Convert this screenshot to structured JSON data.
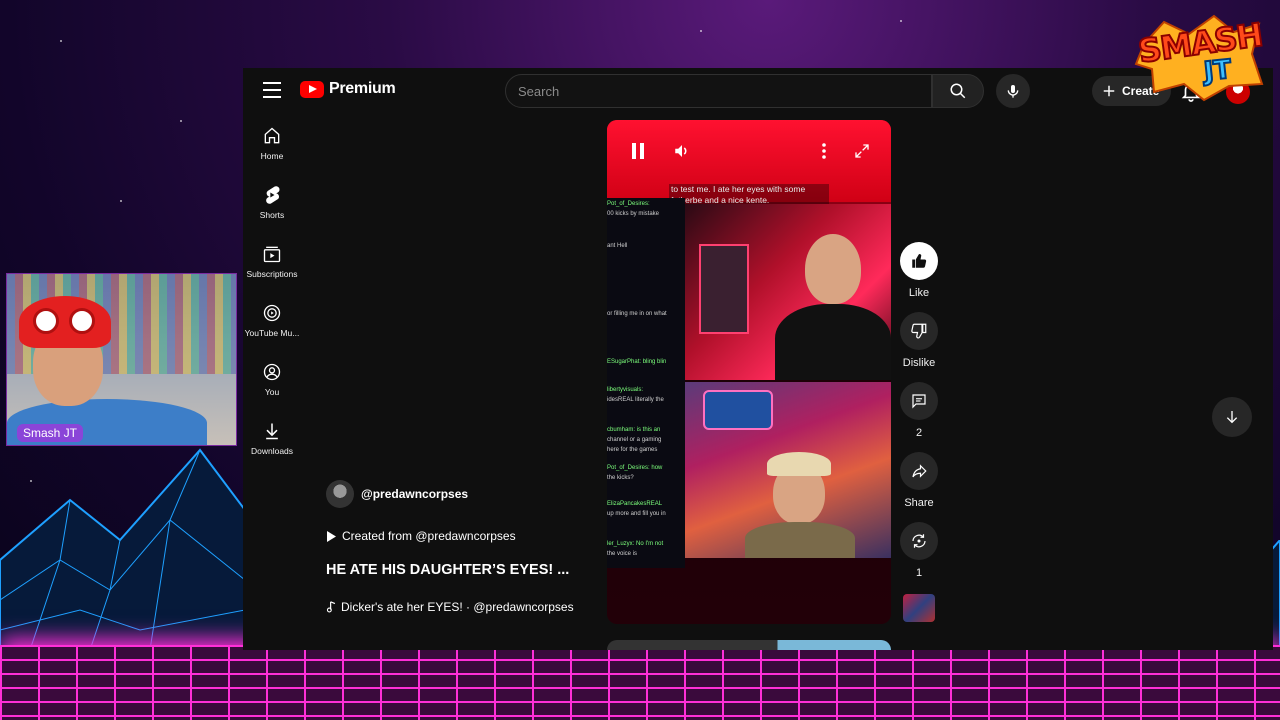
{
  "app": {
    "logo_text": "Premium",
    "search_placeholder": "Search",
    "create_label": "Create",
    "notification_count": "4"
  },
  "sidebar": {
    "items": [
      {
        "label": "Home",
        "icon": "home-icon"
      },
      {
        "label": "Shorts",
        "icon": "shorts-icon"
      },
      {
        "label": "Subscriptions",
        "icon": "subscriptions-icon"
      },
      {
        "label": "YouTube Mu...",
        "icon": "youtube-music-icon"
      },
      {
        "label": "You",
        "icon": "you-icon"
      },
      {
        "label": "Downloads",
        "icon": "download-icon"
      }
    ]
  },
  "video": {
    "caption": "to test me. I ate her eyes with some fatherbe and a nice kente.",
    "chat_lines": [
      "Pot_of_Desires:",
      "00 kicks by mistake",
      "ant Hell",
      "or filling me in on what",
      "ESugarPhat: bling blin",
      "libertyvisuals:",
      "idesREAL literally the",
      "cbumham: is this an",
      "channel or a gaming",
      "here for the games",
      "Pot_of_Desires: how",
      "the kicks?",
      "ElizaPancakesREAL",
      "up more and fill you in",
      "ler_Luzyx: No I'm not",
      "the voice is"
    ]
  },
  "actions": {
    "like_label": "Like",
    "dislike_label": "Dislike",
    "comments_count": "2",
    "share_label": "Share",
    "remix_count": "1"
  },
  "info": {
    "channel": "@predawncorpses",
    "created_from": "Created from @predawncorpses",
    "title": "HE ATE HIS DAUGHTER’S EYES! ...",
    "music": "Dicker's ate her EYES! · @predawncorpses"
  },
  "overlay": {
    "webcam_name": "Smash JT",
    "logo_smash": "SMASH",
    "logo_jt": "JT"
  },
  "colors": {
    "brand_red": "#ff0000",
    "neon_pink": "#ff2fd8",
    "neon_blue": "#1ea0ff",
    "webcam_label": "#8a45d8"
  }
}
